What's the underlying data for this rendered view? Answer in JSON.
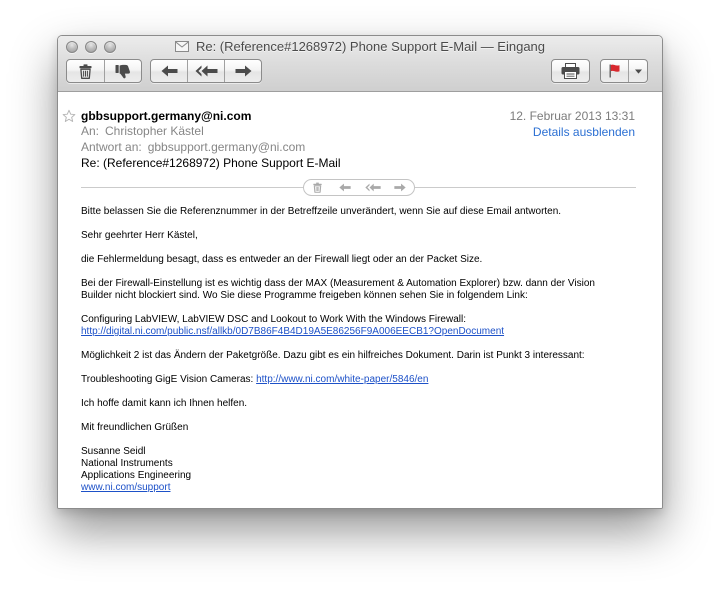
{
  "window": {
    "title": "Re: (Reference#1268972) Phone Support E-Mail — Eingang",
    "title_icon": "envelope-icon"
  },
  "toolbar": {
    "icons": {
      "delete": "trash-icon",
      "junk": "thumbs-down-icon",
      "reply": "reply-arrow-icon",
      "reply_all": "reply-all-arrow-icon",
      "forward": "forward-arrow-icon",
      "print": "printer-icon",
      "flag": "flag-icon",
      "flag_menu": "chevron-down-icon"
    }
  },
  "message": {
    "vip_icon": "star-icon",
    "from": "gbbsupport.germany@ni.com",
    "date": "12. Februar 2013 13:31",
    "details_link": "Details ausblenden",
    "to_label": "An:",
    "to": "Christopher Kästel",
    "reply_to_label": "Antwort an:",
    "reply_to": "gbbsupport.germany@ni.com",
    "subject": "Re: (Reference#1268972) Phone Support E-Mail",
    "inline_action_icons": [
      "trash-icon",
      "reply-arrow-icon",
      "reply-all-arrow-icon",
      "forward-arrow-icon"
    ],
    "body": {
      "notice": "Bitte belassen Sie die Referenznummer in der Betreffzeile unverändert, wenn Sie auf diese Email antworten.",
      "greeting": "Sehr geehrter Herr Kästel,",
      "diagnosis": "die Fehlermeldung besagt, dass es entweder an der Firewall liegt oder an der Packet Size.",
      "firewall_lines": [
        "Bei der Firewall-Einstellung ist es wichtig dass der MAX (Measurement & Automation Explorer) bzw. dann der Vision",
        "Builder nicht blockiert sind. Wo Sie diese Programme freigeben können sehen Sie in folgendem Link:"
      ],
      "firewall_doc_title": "Configuring LabVIEW, LabVIEW DSC and Lookout to Work With the Windows Firewall:",
      "firewall_doc_link": "http://digital.ni.com/public.nsf/allkb/0D7B86F4B4D19A5E86256F9A006EECB1?OpenDocument",
      "packet_size": "Möglichkeit 2 ist das Ändern der Paketgröße. Dazu gibt es ein hilfreiches Dokument. Darin ist Punkt 3 interessant:",
      "gige_label": "Troubleshooting GigE Vision Cameras:",
      "gige_link": "http://www.ni.com/white-paper/5846/en",
      "closing_hope": "Ich hoffe damit kann ich Ihnen helfen.",
      "closing": "Mit freundlichen Grüßen",
      "signature": [
        "Susanne Seidl",
        "National Instruments",
        "Applications Engineering"
      ],
      "signature_link": "www.ni.com/support"
    }
  },
  "colors": {
    "link": "#1d51c8",
    "details_link": "#2c70d3",
    "flag": "#d8282e",
    "meta_text": "#868686"
  }
}
